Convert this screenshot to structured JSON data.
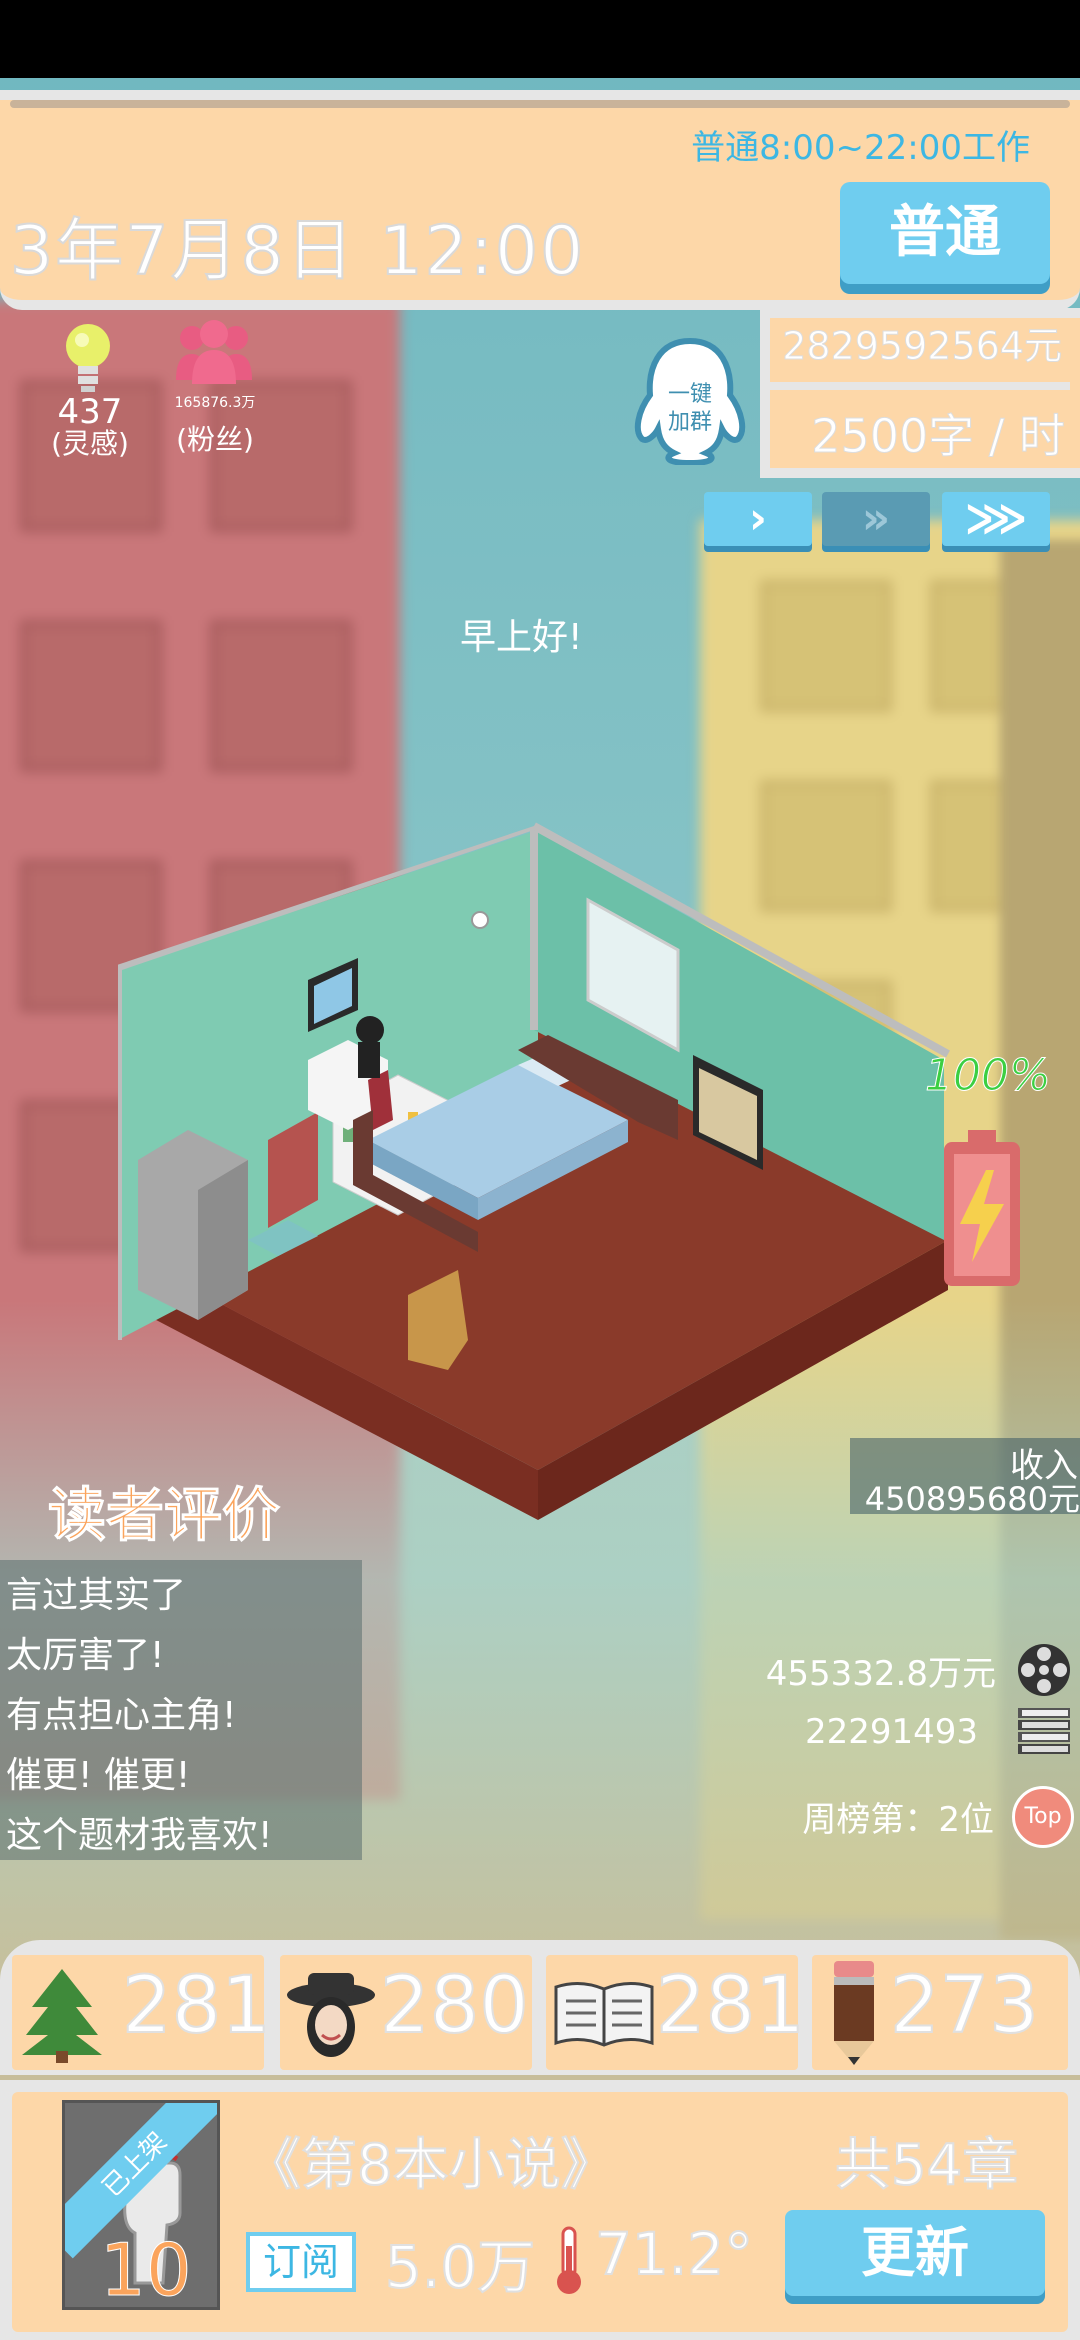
{
  "header": {
    "schedule": "普通8:00~22:00工作",
    "date_time": "3年7月8日   12:00",
    "mode_button": "普通"
  },
  "finance": {
    "money": "2829592564元",
    "writing_speed": "2500字 / 时"
  },
  "speed_controls": {
    "slow": "›",
    "normal": "»",
    "fast": "⋙"
  },
  "inspiration": {
    "value": "437",
    "label": "(灵感)"
  },
  "fans": {
    "value": "165876.3万",
    "label": "(粉丝)"
  },
  "qq_group": {
    "line1": "一键",
    "line2": "加群"
  },
  "greeting": "早上好!",
  "battery": {
    "percent": "100%",
    "level": 1.0
  },
  "income": {
    "label": "收入",
    "value": "450895680元"
  },
  "reviews": {
    "title": "读者评价",
    "items": [
      "言过其实了",
      "太厉害了!",
      "有点担心主角!",
      "催更!  催更!",
      "这个题材我喜欢!"
    ]
  },
  "book_stats": {
    "box_office": "455332.8万元",
    "copies": "22291493",
    "weekly_rank": "周榜第：2位",
    "top_badge": "Top"
  },
  "attributes": [
    {
      "icon": "tree-icon",
      "value": "281"
    },
    {
      "icon": "hat-woman-icon",
      "value": "280"
    },
    {
      "icon": "open-book-icon",
      "value": "281"
    },
    {
      "icon": "pencil-icon",
      "value": "273"
    }
  ],
  "current_book": {
    "status_ribbon": "已上架",
    "cover_number": "10",
    "title": "《第8本小说》",
    "chapters": "共54章",
    "subscribe_label": "订阅",
    "subscriptions": "5.0万",
    "heat": "71.2°",
    "update_button": "更新"
  },
  "colors": {
    "panel": "#fdd7a8",
    "accent_blue": "#6fcdef",
    "review_orange": "#fba45c",
    "battery_green": "#3ccf42"
  }
}
